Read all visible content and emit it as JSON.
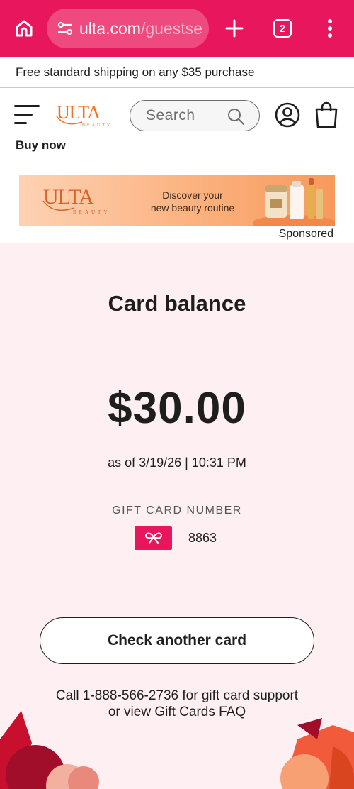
{
  "browser": {
    "url_main": "ulta.com",
    "url_rest": "/guestse",
    "tab_count": "2",
    "icons": [
      "home-icon",
      "site-settings-icon",
      "new-tab-icon",
      "tabs-icon",
      "menu-icon"
    ],
    "accent": "#e8175d"
  },
  "promo": {
    "text": "Free standard shipping on any $35 purchase"
  },
  "header": {
    "search_placeholder": "Search",
    "logo_text": "ULTA",
    "logo_sub": "BEAUTY"
  },
  "content": {
    "buy_now": "Buy now",
    "ad": {
      "logo_text": "ULTA",
      "logo_sub": "BEAUTY",
      "line1": "Discover your",
      "line2": "new beauty routine"
    },
    "sponsored": "Sponsored"
  },
  "gift_card": {
    "title": "Card balance",
    "balance": "$30.00",
    "as_of": "as of 3/19/26 | 10:31 PM",
    "number_label": "GIFT CARD NUMBER",
    "number": "8863",
    "check_button": "Check another card",
    "support_text": "Call 1-888-566-2736 for gift card support",
    "support_or": "or",
    "faq_link": "view Gift Cards FAQ"
  },
  "colors": {
    "brand_pink": "#e8175d",
    "page_pink": "#fdeff2",
    "logo_orange": "#f37021"
  }
}
